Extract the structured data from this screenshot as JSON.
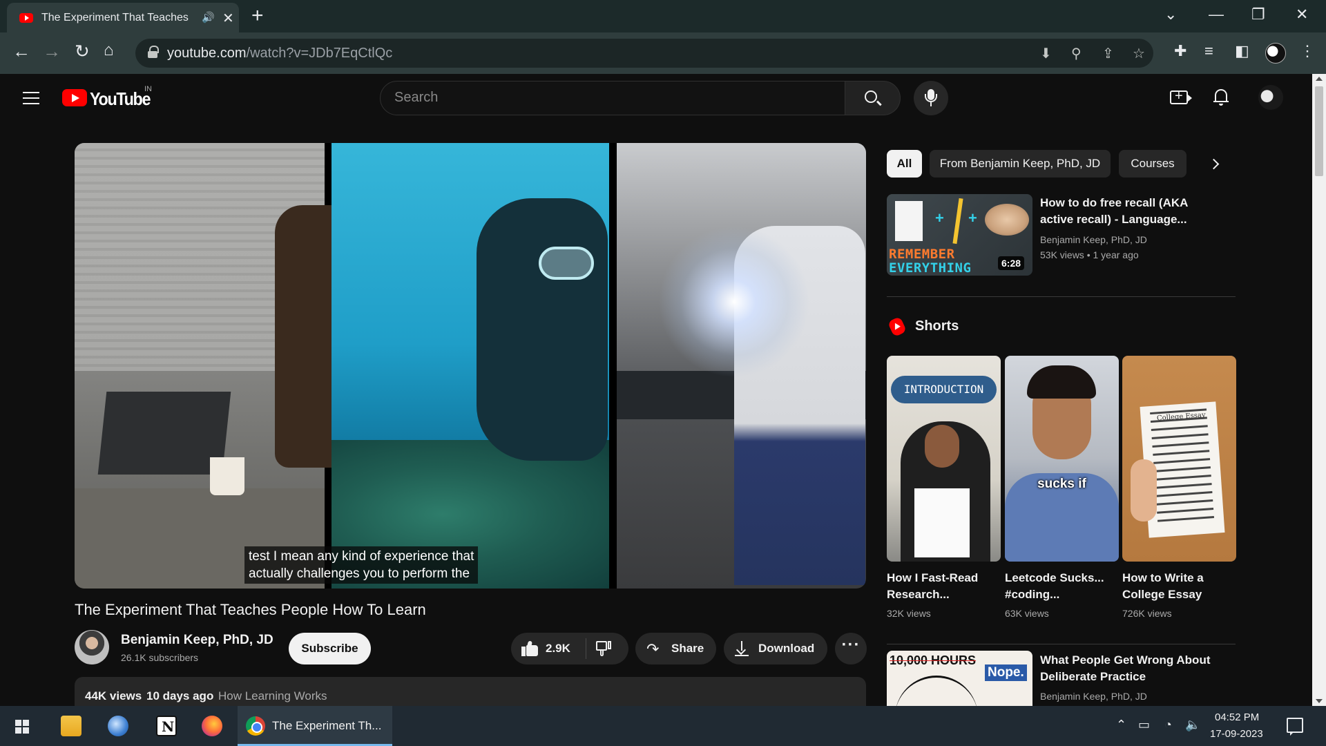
{
  "browser": {
    "tab_title": "The Experiment That Teaches",
    "new_tab": "+",
    "url_host": "youtube.com",
    "url_path": "/watch?v=JDb7EqCtlQc",
    "window_controls": [
      "⌄",
      "—",
      "❐",
      "✕"
    ]
  },
  "masthead": {
    "logo_text": "YouTube",
    "country_code": "IN",
    "search_placeholder": "Search"
  },
  "video": {
    "caption_line1": "test I mean any kind of experience that",
    "caption_line2": "actually challenges you to perform the",
    "title": "The Experiment That Teaches People How To Learn",
    "channel_name": "Benjamin Keep, PhD, JD",
    "subscribers": "26.1K subscribers",
    "subscribe_label": "Subscribe",
    "like_count": "2.9K",
    "share_label": "Share",
    "download_label": "Download",
    "more_label": "···",
    "views": "44K views",
    "date": "10 days ago",
    "tag": "How Learning Works"
  },
  "chips": {
    "all": "All",
    "from": "From Benjamin Keep, PhD, JD",
    "courses": "Courses"
  },
  "recommendations": [
    {
      "title": "How to do free recall (AKA active recall) - Language...",
      "channel": "Benjamin Keep, PhD, JD",
      "meta": "53K views  • 1 year ago",
      "duration": "6:28",
      "thumb_line1": "REMEMBER",
      "thumb_line2": "EVERYTHING"
    },
    {
      "title": "What People Get Wrong About Deliberate Practice",
      "channel": "Benjamin Keep, PhD, JD",
      "thumb_line1": "10,000 HOURS",
      "thumb_badge": "Nope."
    }
  ],
  "shorts": {
    "heading": "Shorts",
    "items": [
      {
        "title": "How I Fast-Read Research...",
        "views": "32K views",
        "badge": "INTRODUCTION"
      },
      {
        "title": "Leetcode Sucks... #coding...",
        "views": "63K views",
        "overlay": "sucks if"
      },
      {
        "title": "How to Write a College Essay",
        "views": "726K views",
        "sheet_label": "College Essay"
      }
    ]
  },
  "taskbar": {
    "active_app_label": "The Experiment Th...",
    "time": "04:52 PM",
    "date": "17-09-2023"
  }
}
